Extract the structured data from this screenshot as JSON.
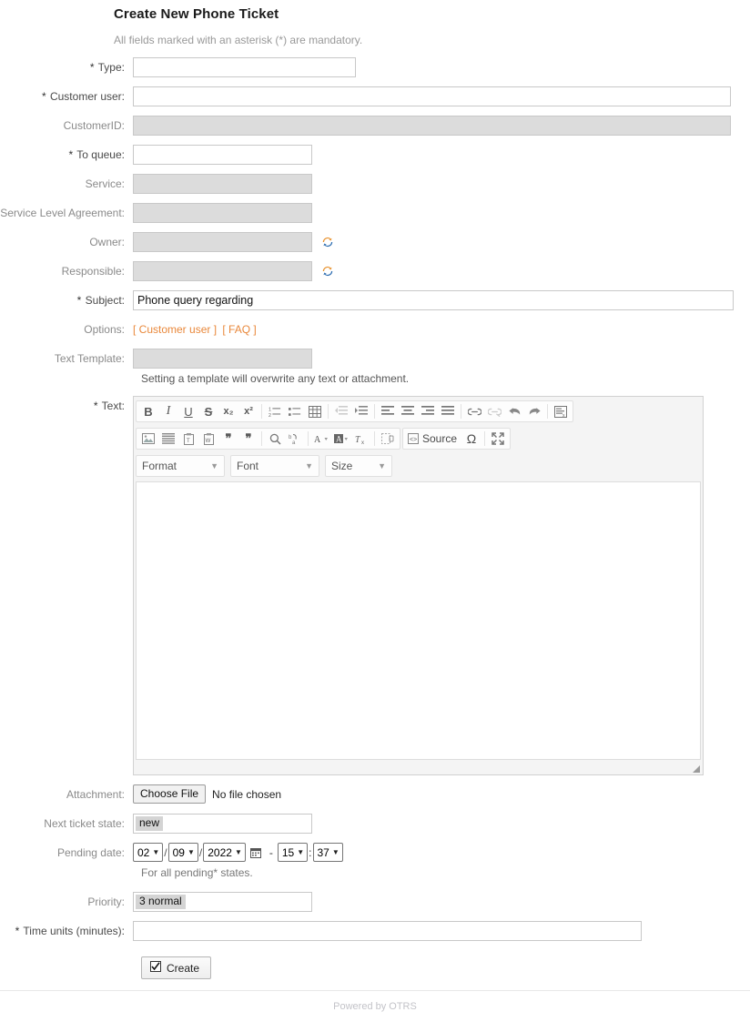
{
  "page": {
    "title": "Create New Phone Ticket",
    "mandatory_note": "All fields marked with an asterisk (*) are mandatory."
  },
  "fields": {
    "type": {
      "label": "Type:",
      "required": true,
      "value": ""
    },
    "customer_user": {
      "label": "Customer user:",
      "required": true,
      "value": ""
    },
    "customer_id": {
      "label": "CustomerID:",
      "required": false,
      "value": "",
      "disabled": true
    },
    "to_queue": {
      "label": "To queue:",
      "required": true,
      "value": ""
    },
    "service": {
      "label": "Service:",
      "required": false,
      "value": "",
      "disabled": true
    },
    "sla": {
      "label": "Service Level Agreement:",
      "required": false,
      "value": "",
      "disabled": true
    },
    "owner": {
      "label": "Owner:",
      "required": false,
      "value": "",
      "disabled": true,
      "refresh_icon": "refresh-icon"
    },
    "responsible": {
      "label": "Responsible:",
      "required": false,
      "value": "",
      "disabled": true,
      "refresh_icon": "refresh-icon"
    },
    "subject": {
      "label": "Subject:",
      "required": true,
      "value": "Phone query regarding"
    },
    "options": {
      "label": "Options:",
      "links": [
        "[ Customer user ]",
        "[ FAQ ]"
      ]
    },
    "text_template": {
      "label": "Text Template:",
      "required": false,
      "value": "",
      "disabled": true
    },
    "template_hint": "Setting a template will overwrite any text or attachment.",
    "text": {
      "label": "Text:",
      "required": true,
      "value": ""
    },
    "attachment": {
      "label": "Attachment:",
      "button_label": "Choose File",
      "file_status": "No file chosen"
    },
    "next_ticket_state": {
      "label": "Next ticket state:",
      "value": "new"
    },
    "pending_date": {
      "label": "Pending date:",
      "month": "02",
      "day": "09",
      "year": "2022",
      "hour": "15",
      "minute": "37",
      "calendar_icon": "calendar-icon",
      "hint": "For all pending* states."
    },
    "priority": {
      "label": "Priority:",
      "value": "3 normal"
    },
    "time_units": {
      "label": "Time units (minutes):",
      "required": true,
      "value": ""
    }
  },
  "editor": {
    "toolbar_row1": [
      {
        "name": "bold-icon",
        "glyph": "B"
      },
      {
        "name": "italic-icon",
        "glyph": "I"
      },
      {
        "name": "underline-icon",
        "glyph": "U"
      },
      {
        "name": "strikethrough-icon",
        "glyph": "S"
      },
      {
        "name": "subscript-icon",
        "glyph": "x₂"
      },
      {
        "name": "superscript-icon",
        "glyph": "x²"
      },
      {
        "name": "numbered-list-icon",
        "glyph": ""
      },
      {
        "name": "bulleted-list-icon",
        "glyph": ""
      },
      {
        "name": "table-icon",
        "glyph": ""
      },
      {
        "name": "decrease-indent-icon",
        "glyph": "",
        "disabled": true
      },
      {
        "name": "increase-indent-icon",
        "glyph": ""
      },
      {
        "name": "align-left-icon",
        "glyph": ""
      },
      {
        "name": "align-center-icon",
        "glyph": ""
      },
      {
        "name": "align-right-icon",
        "glyph": ""
      },
      {
        "name": "align-justify-icon",
        "glyph": ""
      },
      {
        "name": "link-icon",
        "glyph": ""
      },
      {
        "name": "unlink-icon",
        "glyph": "",
        "disabled": true
      },
      {
        "name": "undo-icon",
        "glyph": ""
      },
      {
        "name": "redo-icon",
        "glyph": ""
      },
      {
        "name": "remove-format-block-icon",
        "glyph": ""
      }
    ],
    "toolbar_row2": [
      {
        "name": "image-icon"
      },
      {
        "name": "horizontal-rule-icon"
      },
      {
        "name": "paste-as-plain-text-icon"
      },
      {
        "name": "paste-from-word-icon"
      },
      {
        "name": "blockquote-open-icon"
      },
      {
        "name": "blockquote-close-icon"
      },
      {
        "name": "find-icon"
      },
      {
        "name": "replace-icon"
      },
      {
        "name": "text-color-icon"
      },
      {
        "name": "background-color-icon"
      },
      {
        "name": "remove-format-icon"
      },
      {
        "name": "page-break-icon"
      }
    ],
    "source_label": "Source",
    "special_char_label": "Ω",
    "maximize_label": "maximize-icon",
    "dropdowns": [
      {
        "name": "format-dropdown",
        "label": "Format"
      },
      {
        "name": "font-dropdown",
        "label": "Font"
      },
      {
        "name": "size-dropdown",
        "label": "Size"
      }
    ]
  },
  "submit": {
    "label": "Create",
    "icon": "checkbox-checked-icon"
  },
  "footer": {
    "text": "Powered by OTRS"
  },
  "colors": {
    "link_orange": "#e9883b",
    "label_gray": "#8a8a8a",
    "disabled_bg": "#dcdcdc",
    "footer_gray": "#c3c3c8"
  }
}
